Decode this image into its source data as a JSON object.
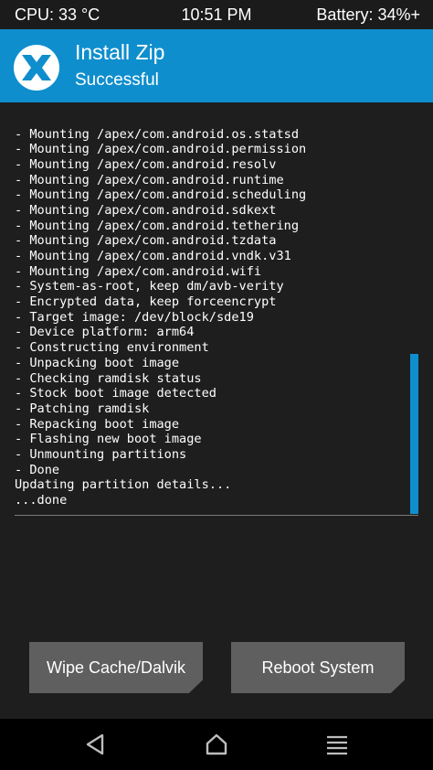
{
  "status_bar": {
    "cpu": "CPU: 33 °C",
    "time": "10:51 PM",
    "battery": "Battery: 34%+"
  },
  "header": {
    "title": "Install Zip",
    "subtitle": "Successful",
    "logo_icon": "twrp-logo-icon"
  },
  "console": {
    "lines": [
      "- Mounting /apex/com.android.os.statsd",
      "- Mounting /apex/com.android.permission",
      "- Mounting /apex/com.android.resolv",
      "- Mounting /apex/com.android.runtime",
      "- Mounting /apex/com.android.scheduling",
      "- Mounting /apex/com.android.sdkext",
      "- Mounting /apex/com.android.tethering",
      "- Mounting /apex/com.android.tzdata",
      "- Mounting /apex/com.android.vndk.v31",
      "- Mounting /apex/com.android.wifi",
      "- System-as-root, keep dm/avb-verity",
      "- Encrypted data, keep forceencrypt",
      "- Target image: /dev/block/sde19",
      "- Device platform: arm64",
      "- Constructing environment",
      "- Unpacking boot image",
      "- Checking ramdisk status",
      "- Stock boot image detected",
      "- Patching ramdisk",
      "- Repacking boot image",
      "- Flashing new boot image",
      "- Unmounting partitions",
      "- Done",
      "Updating partition details...",
      "...done"
    ]
  },
  "buttons": {
    "wipe_cache": "Wipe Cache/Dalvik",
    "reboot_system": "Reboot System"
  },
  "navigation": {
    "back_icon": "back-triangle-icon",
    "home_icon": "home-icon",
    "menu_icon": "menu-lines-icon"
  },
  "colors": {
    "accent": "#0f8ecd",
    "background": "#1e1e1e",
    "button": "#5f5f5f",
    "nav_bar": "#000000"
  }
}
